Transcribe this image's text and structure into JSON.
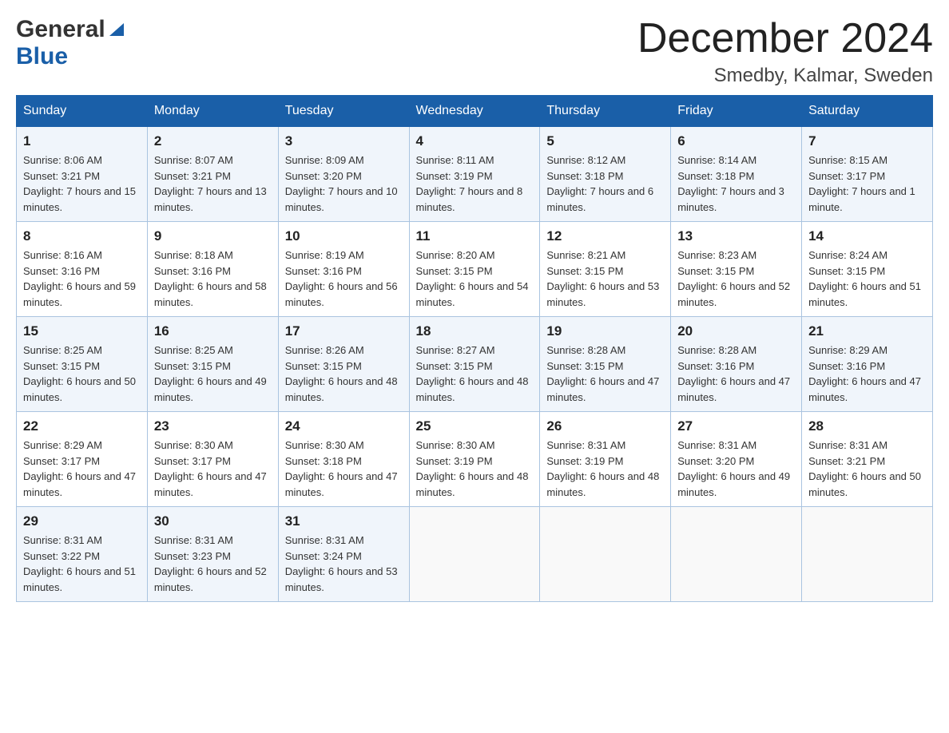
{
  "header": {
    "logo_general": "General",
    "logo_blue": "Blue",
    "month_title": "December 2024",
    "location": "Smedby, Kalmar, Sweden"
  },
  "weekdays": [
    "Sunday",
    "Monday",
    "Tuesday",
    "Wednesday",
    "Thursday",
    "Friday",
    "Saturday"
  ],
  "weeks": [
    [
      {
        "day": "1",
        "sunrise": "8:06 AM",
        "sunset": "3:21 PM",
        "daylight": "7 hours and 15 minutes."
      },
      {
        "day": "2",
        "sunrise": "8:07 AM",
        "sunset": "3:21 PM",
        "daylight": "7 hours and 13 minutes."
      },
      {
        "day": "3",
        "sunrise": "8:09 AM",
        "sunset": "3:20 PM",
        "daylight": "7 hours and 10 minutes."
      },
      {
        "day": "4",
        "sunrise": "8:11 AM",
        "sunset": "3:19 PM",
        "daylight": "7 hours and 8 minutes."
      },
      {
        "day": "5",
        "sunrise": "8:12 AM",
        "sunset": "3:18 PM",
        "daylight": "7 hours and 6 minutes."
      },
      {
        "day": "6",
        "sunrise": "8:14 AM",
        "sunset": "3:18 PM",
        "daylight": "7 hours and 3 minutes."
      },
      {
        "day": "7",
        "sunrise": "8:15 AM",
        "sunset": "3:17 PM",
        "daylight": "7 hours and 1 minute."
      }
    ],
    [
      {
        "day": "8",
        "sunrise": "8:16 AM",
        "sunset": "3:16 PM",
        "daylight": "6 hours and 59 minutes."
      },
      {
        "day": "9",
        "sunrise": "8:18 AM",
        "sunset": "3:16 PM",
        "daylight": "6 hours and 58 minutes."
      },
      {
        "day": "10",
        "sunrise": "8:19 AM",
        "sunset": "3:16 PM",
        "daylight": "6 hours and 56 minutes."
      },
      {
        "day": "11",
        "sunrise": "8:20 AM",
        "sunset": "3:15 PM",
        "daylight": "6 hours and 54 minutes."
      },
      {
        "day": "12",
        "sunrise": "8:21 AM",
        "sunset": "3:15 PM",
        "daylight": "6 hours and 53 minutes."
      },
      {
        "day": "13",
        "sunrise": "8:23 AM",
        "sunset": "3:15 PM",
        "daylight": "6 hours and 52 minutes."
      },
      {
        "day": "14",
        "sunrise": "8:24 AM",
        "sunset": "3:15 PM",
        "daylight": "6 hours and 51 minutes."
      }
    ],
    [
      {
        "day": "15",
        "sunrise": "8:25 AM",
        "sunset": "3:15 PM",
        "daylight": "6 hours and 50 minutes."
      },
      {
        "day": "16",
        "sunrise": "8:25 AM",
        "sunset": "3:15 PM",
        "daylight": "6 hours and 49 minutes."
      },
      {
        "day": "17",
        "sunrise": "8:26 AM",
        "sunset": "3:15 PM",
        "daylight": "6 hours and 48 minutes."
      },
      {
        "day": "18",
        "sunrise": "8:27 AM",
        "sunset": "3:15 PM",
        "daylight": "6 hours and 48 minutes."
      },
      {
        "day": "19",
        "sunrise": "8:28 AM",
        "sunset": "3:15 PM",
        "daylight": "6 hours and 47 minutes."
      },
      {
        "day": "20",
        "sunrise": "8:28 AM",
        "sunset": "3:16 PM",
        "daylight": "6 hours and 47 minutes."
      },
      {
        "day": "21",
        "sunrise": "8:29 AM",
        "sunset": "3:16 PM",
        "daylight": "6 hours and 47 minutes."
      }
    ],
    [
      {
        "day": "22",
        "sunrise": "8:29 AM",
        "sunset": "3:17 PM",
        "daylight": "6 hours and 47 minutes."
      },
      {
        "day": "23",
        "sunrise": "8:30 AM",
        "sunset": "3:17 PM",
        "daylight": "6 hours and 47 minutes."
      },
      {
        "day": "24",
        "sunrise": "8:30 AM",
        "sunset": "3:18 PM",
        "daylight": "6 hours and 47 minutes."
      },
      {
        "day": "25",
        "sunrise": "8:30 AM",
        "sunset": "3:19 PM",
        "daylight": "6 hours and 48 minutes."
      },
      {
        "day": "26",
        "sunrise": "8:31 AM",
        "sunset": "3:19 PM",
        "daylight": "6 hours and 48 minutes."
      },
      {
        "day": "27",
        "sunrise": "8:31 AM",
        "sunset": "3:20 PM",
        "daylight": "6 hours and 49 minutes."
      },
      {
        "day": "28",
        "sunrise": "8:31 AM",
        "sunset": "3:21 PM",
        "daylight": "6 hours and 50 minutes."
      }
    ],
    [
      {
        "day": "29",
        "sunrise": "8:31 AM",
        "sunset": "3:22 PM",
        "daylight": "6 hours and 51 minutes."
      },
      {
        "day": "30",
        "sunrise": "8:31 AM",
        "sunset": "3:23 PM",
        "daylight": "6 hours and 52 minutes."
      },
      {
        "day": "31",
        "sunrise": "8:31 AM",
        "sunset": "3:24 PM",
        "daylight": "6 hours and 53 minutes."
      },
      null,
      null,
      null,
      null
    ]
  ],
  "labels": {
    "sunrise": "Sunrise:",
    "sunset": "Sunset:",
    "daylight": "Daylight:"
  }
}
